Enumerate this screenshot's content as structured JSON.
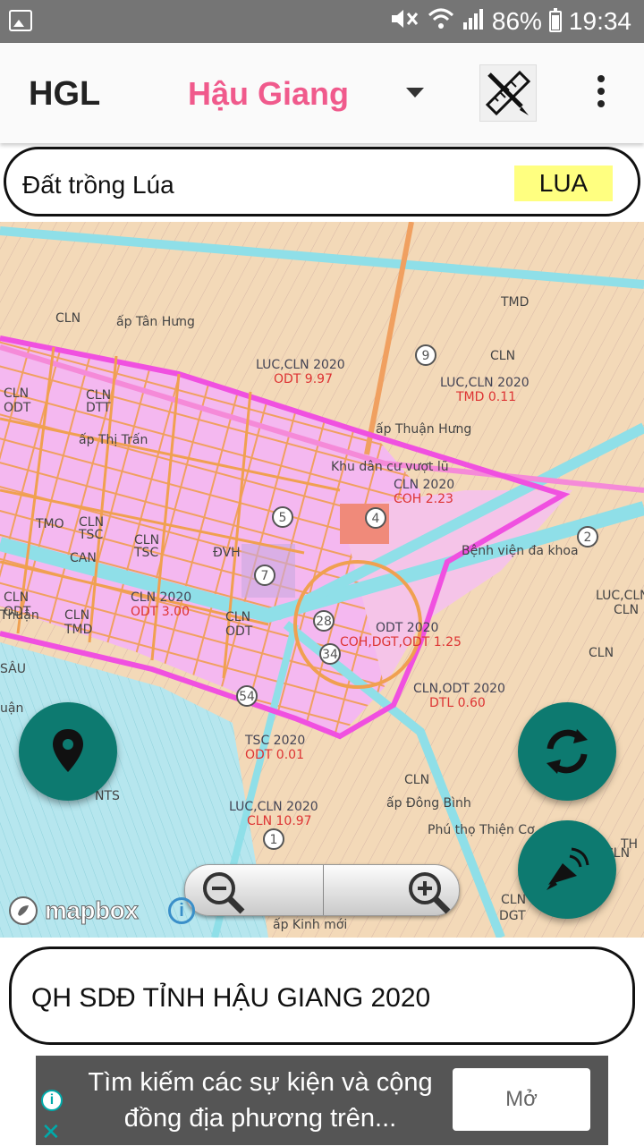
{
  "status_bar": {
    "battery": "86%",
    "time": "19:34"
  },
  "app_bar": {
    "title": "HGL",
    "province": "Hậu Giang"
  },
  "land_use": {
    "name": "Đất trồng Lúa",
    "code": "LUA",
    "code_color": "#ffff80"
  },
  "map": {
    "labels": [
      "CLN",
      "ấp Tân Hưng",
      "TMD",
      "CLN",
      "LUC,CLN 2020",
      "ODT 9.97",
      "LUC,CLN 2020",
      "TMD 0.11",
      "CLN",
      "ODT",
      "CLN",
      "DTT",
      "ấp Thị Trấn",
      "ấp Thuận Hưng",
      "Khu dân cư vượt lũ",
      "CLN 2020",
      "COH 2.23",
      "TMO",
      "CLN",
      "TSC",
      "CLN",
      "TSC",
      "CAN",
      "ĐVH",
      "Bệnh viện đa khoa",
      "CLN",
      "ODT",
      "CLN 2020",
      "ODT 3.00",
      "CLN",
      "TMD",
      "LUC,CLN",
      "CLN",
      "ODT 2020",
      "COH,DGT,ODT 1.25",
      "CLN",
      "ODT",
      "SÂU",
      "CLN",
      "CLN,ODT 2020",
      "DTL 0.60",
      "TSC 2020",
      "ODT 0.01",
      "CLN",
      "ấp Đông Bình",
      "CLN",
      "NTS",
      "LUC,CLN 2020",
      "CLN 10.97",
      "Phú thọ Thiện Cơ",
      "CLN",
      "DGT",
      "CLN",
      "TH",
      "ấp Kinh mới",
      "Thuận",
      "uận"
    ]
  },
  "map_attribution": "mapbox",
  "layer_title": "QH SDĐ TỈNH HẬU GIANG 2020",
  "ad": {
    "text": "Tìm kiếm các sự kiện và cộng đồng địa phương trên...",
    "button": "Mở"
  },
  "icons": {
    "status_left": "gallery-icon",
    "status_right": [
      "mute-icon",
      "wifi-icon",
      "signal-icon",
      "battery-icon"
    ],
    "toolbar": [
      "dropdown-arrow-icon",
      "drawing-tools-icon",
      "more-vert-icon"
    ],
    "map_fabs": [
      "location-pin-icon",
      "refresh-icon",
      "satellite-dish-icon"
    ],
    "zoom": [
      "zoom-out-icon",
      "zoom-in-icon"
    ],
    "ad": [
      "ad-info-icon",
      "ad-close-icon"
    ]
  },
  "colors": {
    "province": "#f05a8c",
    "fab": "#0d7a70",
    "map_land": "#f3d9b8",
    "map_urban": "#f4b8f0",
    "map_water": "#a8e4ec"
  }
}
